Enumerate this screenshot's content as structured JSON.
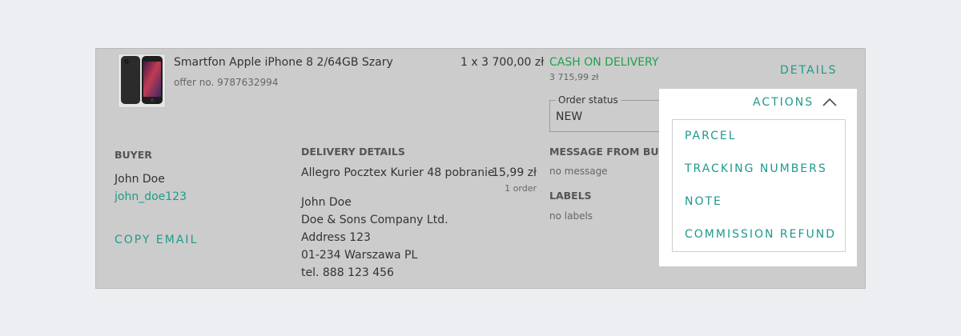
{
  "order": {
    "product_title": "Smartfon Apple iPhone 8 2/64GB Szary",
    "offer_no": "offer no. 9787632994",
    "quantity_price": "1 x 3 700,00 zł",
    "payment_method": "CASH ON DELIVERY",
    "total": "3 715,99 zł",
    "details_link": "DETAILS"
  },
  "status": {
    "legend": "Order status",
    "value": "NEW"
  },
  "buyer": {
    "heading": "BUYER",
    "name": "John Doe",
    "login": "john_doe123",
    "copy_email": "COPY EMAIL"
  },
  "delivery": {
    "heading": "DELIVERY DETAILS",
    "method": "Allegro Pocztex Kurier 48 pobranie",
    "price": "15,99 zł",
    "count": "1 order",
    "address_lines": [
      "John Doe",
      "Doe & Sons Company Ltd.",
      "Address 123",
      "01-234 Warszawa PL",
      "tel. 888 123 456"
    ]
  },
  "message": {
    "heading": "MESSAGE FROM BUYER",
    "value": "no message"
  },
  "labels": {
    "heading": "LABELS",
    "value": "no labels"
  },
  "actions": {
    "label": "ACTIONS",
    "items": [
      "PARCEL",
      "TRACKING NUMBERS",
      "NOTE",
      "COMMISSION REFUND"
    ]
  },
  "colors": {
    "accent": "#1f9a8a",
    "payment_green": "#21a04b",
    "card_bg": "#cccccc",
    "page_bg": "#eceef1"
  },
  "icons": {
    "product_image": "iphone-image",
    "status_dropdown": "chevron-down-icon",
    "actions_toggle": "chevron-up-icon"
  }
}
